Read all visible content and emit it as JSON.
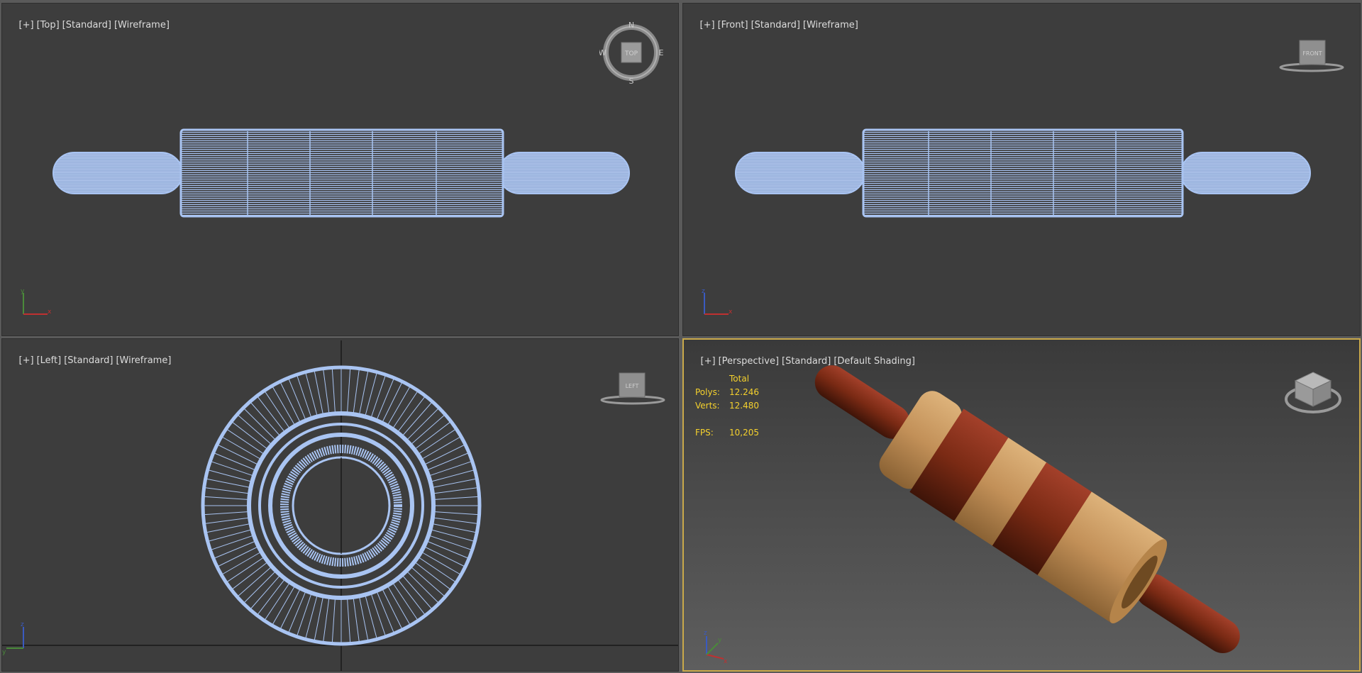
{
  "viewports": {
    "top": {
      "labels": [
        "[+]",
        "[Top]",
        "[Standard]",
        "[Wireframe]"
      ],
      "viewcube": "TOP",
      "compass": [
        "N",
        "E",
        "S",
        "W"
      ],
      "axes": [
        "x",
        "y"
      ]
    },
    "front": {
      "labels": [
        "[+]",
        "[Front]",
        "[Standard]",
        "[Wireframe]"
      ],
      "viewcube": "FRONT",
      "axes": [
        "x",
        "z"
      ]
    },
    "left": {
      "labels": [
        "[+]",
        "[Left]",
        "[Standard]",
        "[Wireframe]"
      ],
      "viewcube": "LEFT",
      "axes": [
        "y",
        "z"
      ]
    },
    "perspective": {
      "labels": [
        "[+]",
        "[Perspective]",
        "[Standard]",
        "[Default Shading]"
      ],
      "axes": [
        "x",
        "y",
        "z"
      ]
    }
  },
  "stats": {
    "header": "Total",
    "polys_label": "Polys:",
    "polys_value": "12.246",
    "verts_label": "Verts:",
    "verts_value": "12.480",
    "fps_label": "FPS:",
    "fps_value": "10,205"
  },
  "colors": {
    "viewport_bg": "#3d3d3d",
    "wireframe": "#a9c4f2",
    "active_border": "#c9a94a",
    "stats_text": "#f5d12d",
    "wood_dark": "#7a2a14",
    "wood_light": "#c9975e"
  }
}
